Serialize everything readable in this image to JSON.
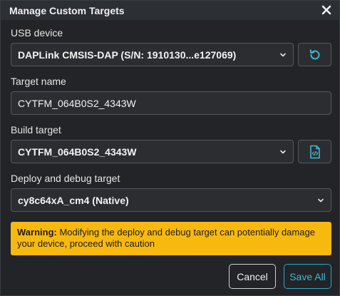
{
  "dialog": {
    "title": "Manage Custom Targets",
    "close_icon": "close-icon"
  },
  "usb_device": {
    "label": "USB device",
    "selected": "DAPLink CMSIS-DAP (S/N: 1910130...e127069)",
    "refresh_icon": "refresh-icon"
  },
  "target_name": {
    "label": "Target name",
    "value": "CYTFM_064B0S2_4343W"
  },
  "build_target": {
    "label": "Build target",
    "selected": "CYTFM_064B0S2_4343W",
    "code_file_icon": "code-file-icon"
  },
  "deploy_target": {
    "label": "Deploy and debug target",
    "selected": "cy8c64xA_cm4 (Native)"
  },
  "warning": {
    "prefix": "Warning:",
    "text": " Modifying the deploy and debug target can potentially damage your device, proceed with caution"
  },
  "actions": {
    "cancel": "Cancel",
    "save_all": "Save All"
  },
  "colors": {
    "accent": "#3fb8d2",
    "warning_bg": "#f8b90f",
    "background": "#222427"
  }
}
